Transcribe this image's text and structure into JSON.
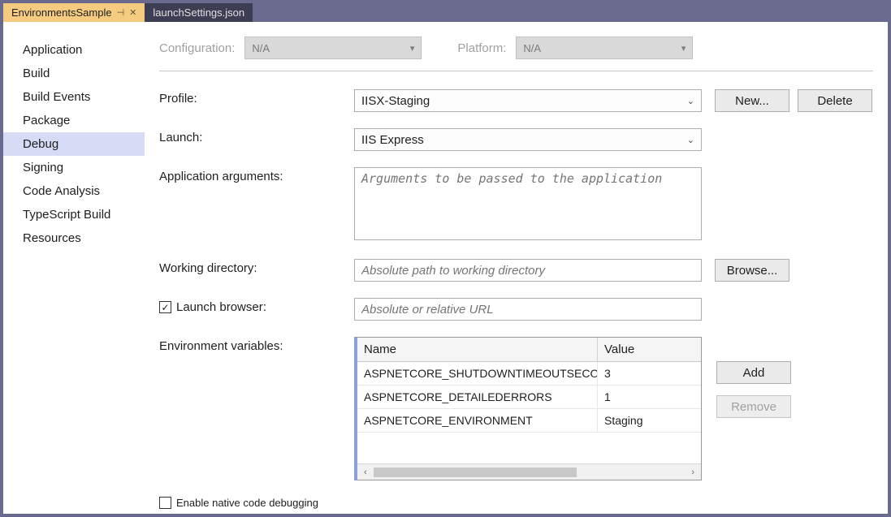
{
  "tabs": {
    "active": "EnvironmentsSample",
    "inactive": "launchSettings.json"
  },
  "sidebar": {
    "items": [
      "Application",
      "Build",
      "Build Events",
      "Package",
      "Debug",
      "Signing",
      "Code Analysis",
      "TypeScript Build",
      "Resources"
    ],
    "selected": "Debug"
  },
  "top": {
    "config_label": "Configuration:",
    "config_value": "N/A",
    "platform_label": "Platform:",
    "platform_value": "N/A"
  },
  "form": {
    "profile_label": "Profile:",
    "profile_value": "IISX-Staging",
    "new_btn": "New...",
    "delete_btn": "Delete",
    "launch_label": "Launch:",
    "launch_value": "IIS Express",
    "args_label": "Application arguments:",
    "args_placeholder": "Arguments to be passed to the application",
    "workdir_label": "Working directory:",
    "workdir_placeholder": "Absolute path to working directory",
    "browse_btn": "Browse...",
    "launch_browser_label": "Launch browser:",
    "launch_browser_placeholder": "Absolute or relative URL",
    "env_label": "Environment variables:",
    "add_btn": "Add",
    "remove_btn": "Remove",
    "native_debug_label": "Enable native code debugging"
  },
  "grid": {
    "col_name": "Name",
    "col_value": "Value",
    "rows": [
      {
        "name": "ASPNETCORE_SHUTDOWNTIMEOUTSECONDS",
        "value": "3"
      },
      {
        "name": "ASPNETCORE_DETAILEDERRORS",
        "value": "1"
      },
      {
        "name": "ASPNETCORE_ENVIRONMENT",
        "value": "Staging"
      }
    ]
  }
}
